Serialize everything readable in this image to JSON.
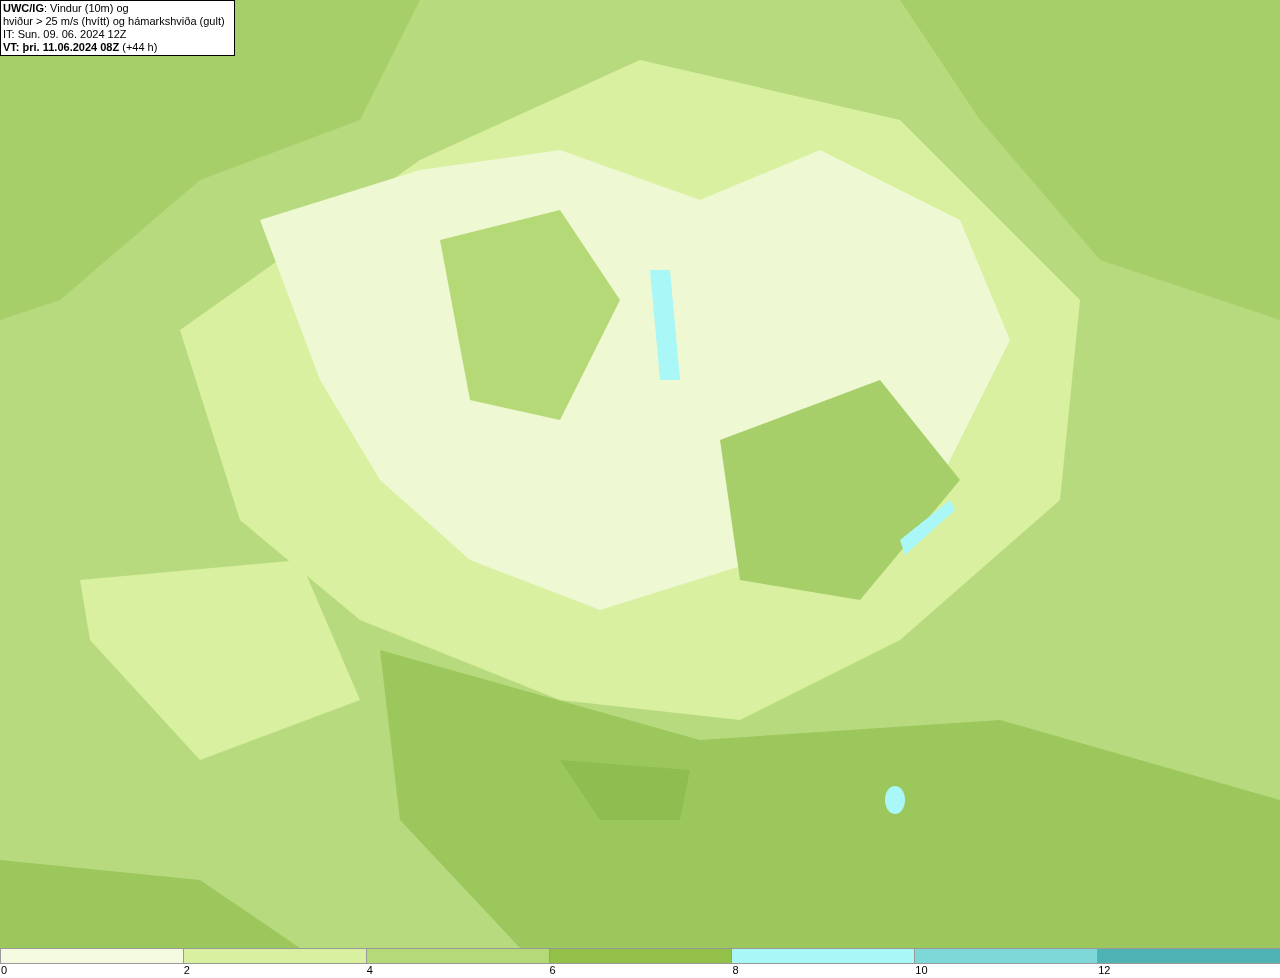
{
  "legend": {
    "lines": [
      "**UWC/IG**: Vindur (10m) og",
      "hviður > 25 m/s (hvítt) og hámarkshviða (gult)",
      "IT: Sun. 09. 06. 2024 12Z",
      "**VT: þri. 11.06.2024 08Z** (+44 h)"
    ]
  },
  "colorbar": {
    "segments": [
      {
        "color": "#f4fbe0"
      },
      {
        "color": "#d9f0a0"
      },
      {
        "color": "#b5d977"
      },
      {
        "color": "#93c047"
      },
      {
        "color": "#aaf7f7"
      },
      {
        "color": "#7fd8d8"
      },
      {
        "color": "#4fb3b3"
      }
    ],
    "ticks": [
      "0",
      "2",
      "4",
      "6",
      "8",
      "10",
      "12"
    ]
  }
}
